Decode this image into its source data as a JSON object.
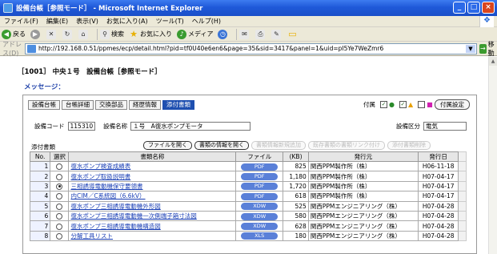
{
  "window": {
    "title": "設備台帳［参照モード］ - Microsoft Internet Explorer"
  },
  "menu": [
    "ファイル(F)",
    "編集(E)",
    "表示(V)",
    "お気に入り(A)",
    "ツール(T)",
    "ヘルプ(H)"
  ],
  "toolbar": {
    "back": "戻る",
    "search": "検索",
    "favorites": "お気に入り",
    "media": "メディア"
  },
  "address": {
    "label": "アドレス(D)",
    "url": "http://192.168.0.51/ppmes/ecp/detail.html?pid=tf0U40e6en6&page=35&sid=3417&panel=1&uid=pI5Ye7WeZmr6",
    "go": "移動"
  },
  "page": {
    "heading": "［1001］ 中央１号　設備台帳［参照モード］",
    "message_label": "メッセージ："
  },
  "tabs": [
    "設備台帳",
    "台帳詳細",
    "交換部品",
    "経歴情報",
    "添付書類"
  ],
  "legend": {
    "label": "付属",
    "settings_button": "付属設定"
  },
  "fields": {
    "code_label": "設備コード",
    "code_value": "115310",
    "name_label": "設備名称",
    "name_value": "１号　A復水ポンプモータ",
    "class_label": "設備区分",
    "class_value": "電気"
  },
  "attachments": {
    "label": "添付書類",
    "buttons": [
      "ファイルを開く",
      "書類の情報を開く",
      "書類情報新規追加",
      "既存書類の書類リンク付け",
      "添付書類削除"
    ]
  },
  "table": {
    "headers": [
      "No.",
      "選択",
      "書類名称",
      "ファイル",
      "(KB)",
      "発行元",
      "発行日"
    ],
    "rows": [
      {
        "no": "1",
        "selected": false,
        "name": "復水ポンプ検査成績表",
        "ftype": "PDF",
        "kb": "825",
        "issuer": "関西PPM製作所（株）",
        "date": "H06-11-18"
      },
      {
        "no": "2",
        "selected": false,
        "name": "復水ポンプ取扱説明書",
        "ftype": "PDF",
        "kb": "1,180",
        "issuer": "関西PPM製作所（株）",
        "date": "H07-04-17"
      },
      {
        "no": "3",
        "selected": true,
        "name": "三相誘導電動機保守要領書",
        "ftype": "PDF",
        "kb": "1,720",
        "issuer": "関西PPM製作所（株）",
        "date": "H07-04-17"
      },
      {
        "no": "4",
        "selected": false,
        "name": "内CIM／C系統図（6.6kV）",
        "ftype": "PDF",
        "kb": "618",
        "issuer": "関西PPM製作所（株）",
        "date": "H07-04-17"
      },
      {
        "no": "5",
        "selected": false,
        "name": "復水ポンプ三相誘導電動機外形図",
        "ftype": "XDW",
        "kb": "525",
        "issuer": "関西PPMエンジニアリング（株）",
        "date": "H07-04-28"
      },
      {
        "no": "6",
        "selected": false,
        "name": "復水ポンプ三相誘導電動機一次側端子箱寸法図",
        "ftype": "XDW",
        "kb": "580",
        "issuer": "関西PPMエンジニアリング（株）",
        "date": "H07-04-28"
      },
      {
        "no": "7",
        "selected": false,
        "name": "復水ポンプ三相誘導電動機構造図",
        "ftype": "XDW",
        "kb": "628",
        "issuer": "関西PPMエンジニアリング（株）",
        "date": "H07-04-28"
      },
      {
        "no": "8",
        "selected": false,
        "name": "分解工具リスト",
        "ftype": "XLS",
        "kb": "180",
        "issuer": "関西PPMエンジニアリング（株）",
        "date": "H07-04-28"
      }
    ]
  },
  "colors": {
    "title_bar": "#1f59d9",
    "active_tab": "#1e4fb0",
    "file_pill": "#5a80d8",
    "link": "#1a3fb5"
  }
}
